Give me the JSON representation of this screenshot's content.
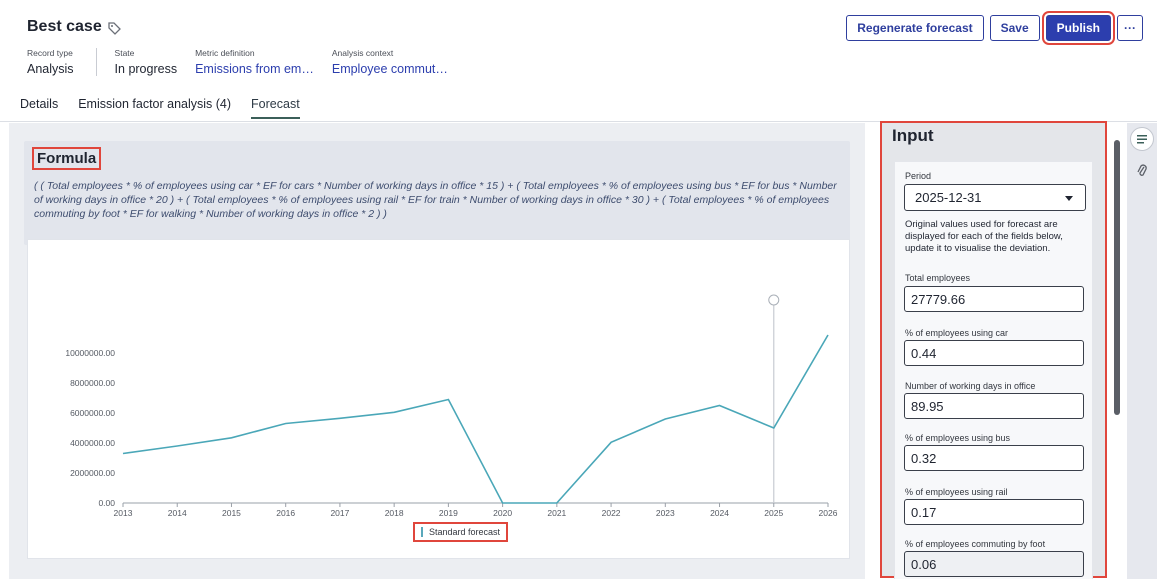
{
  "header": {
    "title": "Best case",
    "actions": {
      "regenerate": "Regenerate forecast",
      "save": "Save",
      "publish": "Publish",
      "more": "···"
    },
    "meta": [
      {
        "label": "Record type",
        "value": "Analysis"
      },
      {
        "label": "State",
        "value": "In progress"
      },
      {
        "label": "Metric definition",
        "value": "Emissions from em…"
      },
      {
        "label": "Analysis context",
        "value": "Employee commut…"
      }
    ],
    "tabs": [
      "Details",
      "Emission factor analysis (4)",
      "Forecast"
    ],
    "active_tab": "Forecast"
  },
  "formula": {
    "title": "Formula",
    "text": "( ( Total employees * % of employees using car * EF for cars * Number of working days in office * 15 ) + ( Total employees * % of employees using bus * EF for bus * Number of working days in office * 20 ) + ( Total employees * % of employees using rail * EF for train * Number of working days in office * 30 ) + ( Total employees * % of employees commuting by foot * EF for walking * Number of working days in office * 2 ) )"
  },
  "chart_data": {
    "type": "line",
    "x": [
      2013,
      2014,
      2015,
      2016,
      2017,
      2018,
      2019,
      2020,
      2021,
      2022,
      2023,
      2024,
      2025,
      2026
    ],
    "series": [
      {
        "name": "Standard forecast",
        "values": [
          3300000,
          3800000,
          4350000,
          5300000,
          5650000,
          6050000,
          6900000,
          0,
          0,
          4050000,
          5600000,
          6500000,
          5000000,
          11200000
        ]
      }
    ],
    "ylim": [
      0,
      11000000
    ],
    "yticks": [
      "0.00",
      "2000000.00",
      "4000000.00",
      "6000000.00",
      "8000000.00",
      "10000000.00"
    ],
    "highlight_x": 2025,
    "line_color": "#4aa7b8",
    "legend_position": "bottom-center"
  },
  "input": {
    "title": "Input",
    "period_label": "Period",
    "period_value": "2025-12-31",
    "help_text": "Original values used for forecast are displayed for each of the fields below, update it to visualise the deviation.",
    "fields": [
      {
        "label": "Total employees",
        "value": "27779.66"
      },
      {
        "label": "% of employees using car",
        "value": "0.44"
      },
      {
        "label": "Number of working days in office",
        "value": "89.95"
      },
      {
        "label": "% of employees using bus",
        "value": "0.32"
      },
      {
        "label": "% of employees using rail",
        "value": "0.17"
      },
      {
        "label": "% of employees commuting by foot",
        "value": "0.06"
      }
    ]
  },
  "colors": {
    "primary": "#2c3eae",
    "highlight_outline": "#e0463c",
    "series": "#4aa7b8"
  }
}
